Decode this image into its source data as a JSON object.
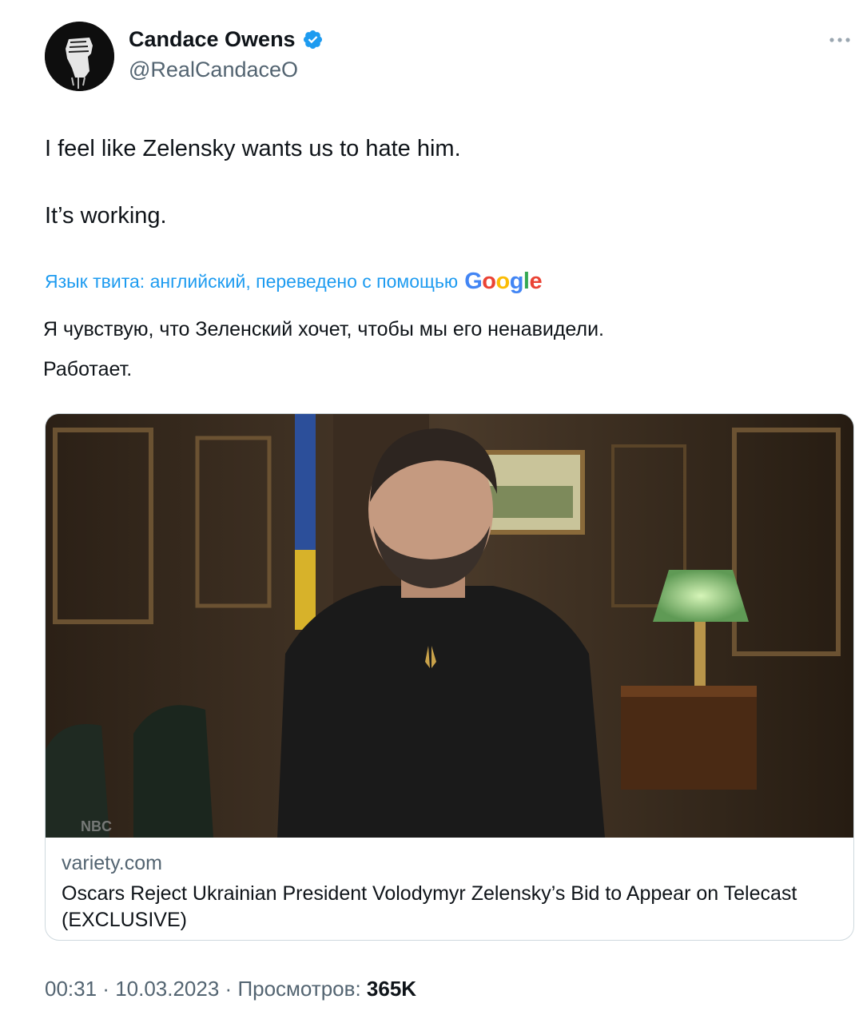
{
  "author": {
    "name": "Candace Owens",
    "handle": "@RealCandaceO",
    "verified": true,
    "avatar_icon": "raised-fist-icon"
  },
  "tweet": {
    "lines": [
      "I feel like Zelensky wants us to hate him.",
      "It’s working."
    ]
  },
  "translation": {
    "notice": "Язык твита: английский, переведено с помощью",
    "provider": "Google",
    "lines": [
      "Я чувствую, что Зеленский хочет, чтобы мы его ненавидели.",
      "Работает."
    ]
  },
  "card": {
    "domain": "variety.com",
    "headline": "Oscars Reject Ukrainian President Volodymyr Zelensky’s Bid to Appear on Telecast (EXCLUSIVE)",
    "watermark": "NBC"
  },
  "meta": {
    "time": "00:31",
    "separator": " · ",
    "date": "10.03.2023",
    "views_label": "Просмотров: ",
    "views_count": "365K"
  },
  "colors": {
    "link": "#1d9bf0",
    "secondary_text": "#536471",
    "primary_text": "#0f1419",
    "border": "#cfd9de"
  }
}
